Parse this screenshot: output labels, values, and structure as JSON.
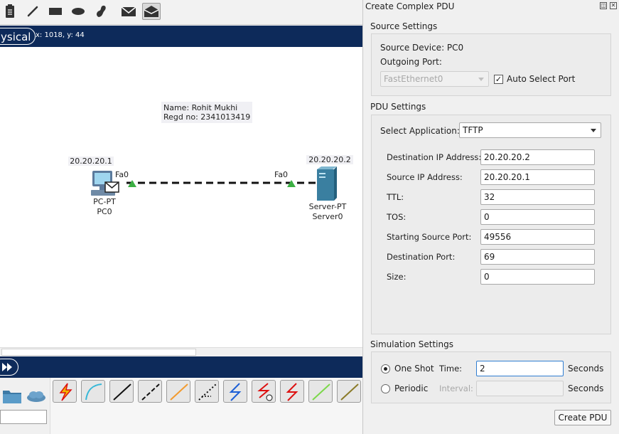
{
  "toolbar": {
    "icons": [
      "note-icon",
      "line-draw-icon",
      "rectangle-icon",
      "ellipse-icon",
      "freeform-icon",
      "simple-pdu-icon",
      "complex-pdu-icon"
    ]
  },
  "mode_bar": {
    "mode_label": "ysical",
    "coordinates": "x: 1018, y: 44"
  },
  "workspace": {
    "note": {
      "line1": "Name: Rohit Mukhi",
      "line2": "Regd no: 2341013419"
    },
    "pc": {
      "ip": "20.20.20.1",
      "port": "Fa0",
      "type": "PC-PT",
      "name": "PC0"
    },
    "server": {
      "ip": "20.20.20.2",
      "port": "Fa0",
      "type": "Server-PT",
      "name": "Server0"
    },
    "colors": {
      "link": "#111111",
      "port_up": "#3cb043",
      "server": "#3a7fa0"
    }
  },
  "bottom_palette": {
    "cables": [
      "auto-connect-icon",
      "console-cable-icon",
      "copper-straight-icon",
      "copper-cross-icon",
      "fiber-icon",
      "phone-cable-icon",
      "coaxial-icon",
      "serial-dce-icon",
      "serial-dte-icon",
      "octal-cable-icon",
      "iot-cable-icon"
    ]
  },
  "dialog": {
    "title": "Create Complex PDU",
    "source_settings": {
      "title": "Source Settings",
      "source_device": "Source Device: PC0",
      "outgoing_port_label": "Outgoing Port:",
      "port_value": "FastEthernet0",
      "auto_select_label": "Auto Select Port",
      "auto_select_checked": true
    },
    "pdu_settings": {
      "title": "PDU Settings",
      "app_label": "Select Application:",
      "app_value": "TFTP",
      "fields": [
        {
          "label": "Destination IP Address:",
          "value": "20.20.20.2"
        },
        {
          "label": "Source IP Address:",
          "value": "20.20.20.1"
        },
        {
          "label": "TTL:",
          "value": "32"
        },
        {
          "label": "TOS:",
          "value": "0"
        },
        {
          "label": "Starting Source Port:",
          "value": "49556"
        },
        {
          "label": "Destination Port:",
          "value": "69"
        },
        {
          "label": "Size:",
          "value": "0"
        }
      ]
    },
    "simulation_settings": {
      "title": "Simulation Settings",
      "one_shot_label": "One Shot",
      "time_label": "Time:",
      "time_value": "2",
      "seconds_label": "Seconds",
      "periodic_label": "Periodic",
      "interval_label": "Interval:",
      "interval_value": "",
      "selected": "One Shot"
    },
    "create_button": "Create PDU"
  }
}
